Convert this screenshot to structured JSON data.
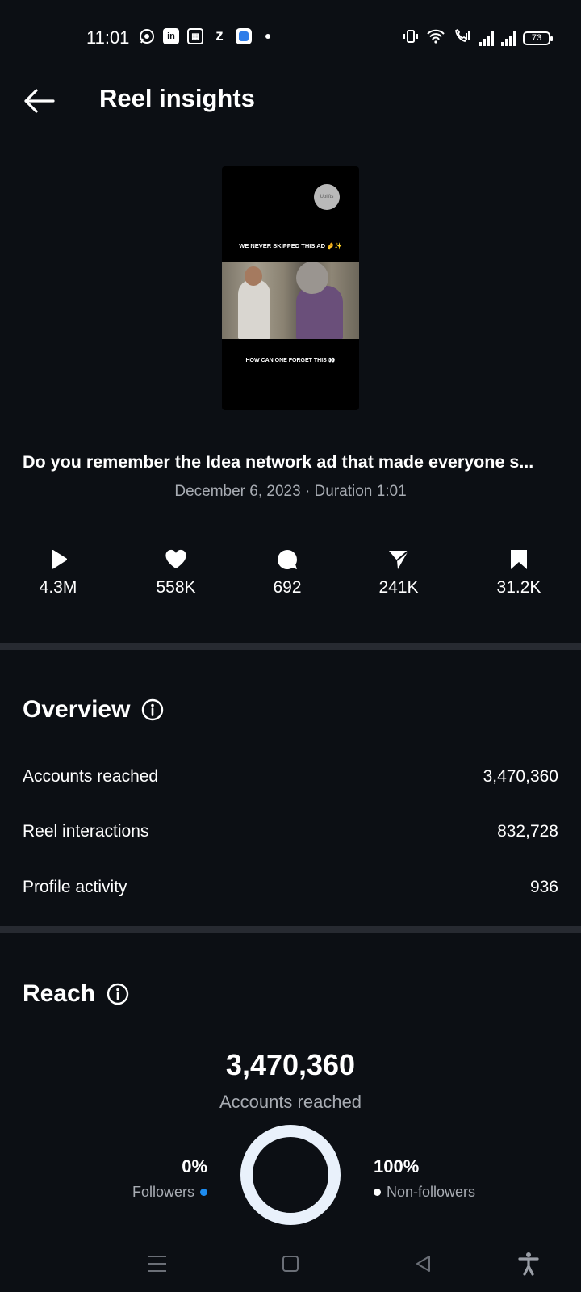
{
  "status_bar": {
    "time": "11:01",
    "left_icons": [
      "whatsapp-icon",
      "linkedin-icon",
      "news-icon",
      "zomato-icon",
      "app-icon",
      "dot-icon"
    ],
    "right_icons": [
      "vibrate-icon",
      "wifi-icon",
      "wifi-call-icon",
      "signal-1-icon",
      "signal-2-icon"
    ],
    "battery": "73"
  },
  "header": {
    "title": "Reel insights",
    "back_icon": "arrow-left-icon"
  },
  "reel": {
    "thumb_logo": "Uplifts",
    "thumb_top_text": "WE NEVER SKIPPED THIS AD 🤌✨",
    "thumb_bottom_text": "HOW CAN ONE FORGET THIS 👀",
    "caption": "Do you remember the Idea network ad that made everyone s...",
    "meta": "December 6, 2023 · Duration 1:01"
  },
  "stats": [
    {
      "icon": "play-icon",
      "value": "4.3M"
    },
    {
      "icon": "heart-icon",
      "value": "558K"
    },
    {
      "icon": "comment-icon",
      "value": "692"
    },
    {
      "icon": "share-icon",
      "value": "241K"
    },
    {
      "icon": "bookmark-icon",
      "value": "31.2K"
    }
  ],
  "overview": {
    "title": "Overview",
    "rows": [
      {
        "label": "Accounts reached",
        "value": "3,470,360"
      },
      {
        "label": "Reel interactions",
        "value": "832,728"
      },
      {
        "label": "Profile activity",
        "value": "936"
      }
    ]
  },
  "reach": {
    "title": "Reach",
    "total": "3,470,360",
    "total_label": "Accounts reached",
    "followers_pct": "0%",
    "followers_label": "Followers",
    "followers_color": "#1d8cf0",
    "nonfollowers_pct": "100%",
    "nonfollowers_label": "Non-followers",
    "nonfollowers_color": "#e9f1fb"
  },
  "nav": {
    "icons": [
      "menu-icon",
      "home-square-icon",
      "back-triangle-icon",
      "accessibility-icon"
    ]
  }
}
